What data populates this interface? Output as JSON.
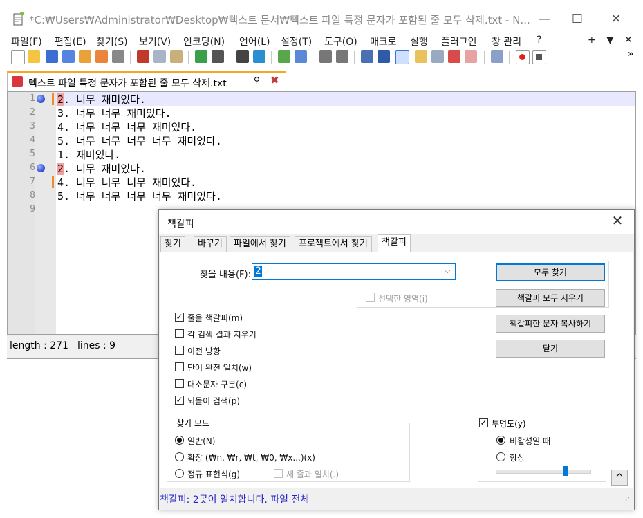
{
  "window": {
    "title": "*C:₩Users₩Administrator₩Desktop₩텍스트 문서₩텍스트 파일 특정 문자가 포함된 줄 모두 삭제.txt - N...",
    "controls": {
      "minimize": "—",
      "maximize": "☐",
      "close": "✕"
    }
  },
  "menu": {
    "items": [
      "파일(F)",
      "편집(E)",
      "찾기(S)",
      "보기(V)",
      "인코딩(N)",
      "언어(L)",
      "설정(T)",
      "도구(O)",
      "매크로",
      "실행",
      "플러그인",
      "창 관리",
      "?"
    ],
    "right": [
      "+",
      "▼",
      "✕"
    ]
  },
  "toolbar": {
    "overflow": "»",
    "icons": [
      "new-file-icon",
      "open-file-icon",
      "save-icon",
      "save-all-icon",
      "close-icon",
      "close-all-icon",
      "print-icon",
      "cut-icon",
      "copy-icon",
      "paste-icon",
      "undo-icon",
      "redo-icon",
      "find-icon",
      "replace-icon",
      "zoom-in-icon",
      "zoom-out-icon",
      "sync-v-icon",
      "sync-h-icon",
      "wrap-icon",
      "all-chars-icon",
      "indent-guide-icon",
      "doc-map-icon",
      "function-list-icon",
      "folder-workspace-icon",
      "monitor-icon",
      "record-icon",
      "stop-icon"
    ]
  },
  "tab": {
    "label": "텍스트 파일 특정 문자가 포함된 줄 모두 삭제.txt",
    "pin": "📌",
    "close": "✖"
  },
  "editor": {
    "lines": [
      {
        "n": "1",
        "pre": "",
        "hl": "2",
        "rest": ". 너무 재미있다.",
        "bookmark": true,
        "changed": true
      },
      {
        "n": "2",
        "pre": "3. 너무 너무 재미있다.",
        "hl": "",
        "rest": "",
        "bookmark": false,
        "changed": false
      },
      {
        "n": "3",
        "pre": "4. 너무 너무 너무 재미있다.",
        "hl": "",
        "rest": "",
        "bookmark": false,
        "changed": false
      },
      {
        "n": "4",
        "pre": "5. 너무 너무 너무 너무 재미있다.",
        "hl": "",
        "rest": "",
        "bookmark": false,
        "changed": false
      },
      {
        "n": "5",
        "pre": "1. 재미있다.",
        "hl": "",
        "rest": "",
        "bookmark": false,
        "changed": false
      },
      {
        "n": "6",
        "pre": "",
        "hl": "2",
        "rest": ". 너무 재미있다.",
        "bookmark": true,
        "changed": false
      },
      {
        "n": "7",
        "pre": "4. 너무 너무 너무 재미있다.",
        "hl": "",
        "rest": "",
        "bookmark": false,
        "changed": true
      },
      {
        "n": "8",
        "pre": "5. 너무 너무 너무 너무 재미있다.",
        "hl": "",
        "rest": "",
        "bookmark": false,
        "changed": false
      },
      {
        "n": "9",
        "pre": "",
        "hl": "",
        "rest": "",
        "bookmark": false,
        "changed": false
      }
    ]
  },
  "status": {
    "length": "length : 271",
    "lines": "lines : 9"
  },
  "dialog": {
    "title": "책갈피",
    "close": "✕",
    "tabs": [
      "찾기",
      "바꾸기",
      "파일에서 찾기",
      "프로젝트에서 찾기",
      "책갈피"
    ],
    "find_label": "찾을 내용(F):",
    "find_value": "2",
    "in_selection": "선택한 영역(i)",
    "buttons": {
      "find_all": "모두 찾기",
      "clear_bookmarks": "책갈피 모두 지우기",
      "copy_bookmarked": "책갈피한 문자 복사하기",
      "close": "닫기"
    },
    "options": [
      {
        "label": "줄을 책갈피(m)",
        "checked": true
      },
      {
        "label": "각 검색 결과 지우기",
        "checked": false
      },
      {
        "label": "이전 방향",
        "checked": false
      },
      {
        "label": "단어 완전 일치(w)",
        "checked": false
      },
      {
        "label": "대소문자 구분(c)",
        "checked": false
      },
      {
        "label": "되돌이 검색(p)",
        "checked": true
      }
    ],
    "search_mode": {
      "title": "찾기 모드",
      "normal": "일반(N)",
      "extended": "확장 (₩n, ₩r, ₩t, ₩0, ₩x...)(x)",
      "regex": "정규 표현식(g)",
      "matches_newline": "새 줄과 일치(.)"
    },
    "transparency": {
      "title": "투명도(y)",
      "on_lose_focus": "비활성일 때",
      "always": "항상",
      "level": 0.74
    },
    "collapse": "^",
    "status": "책갈피: 2곳이 일치합니다. 파일 전체"
  }
}
